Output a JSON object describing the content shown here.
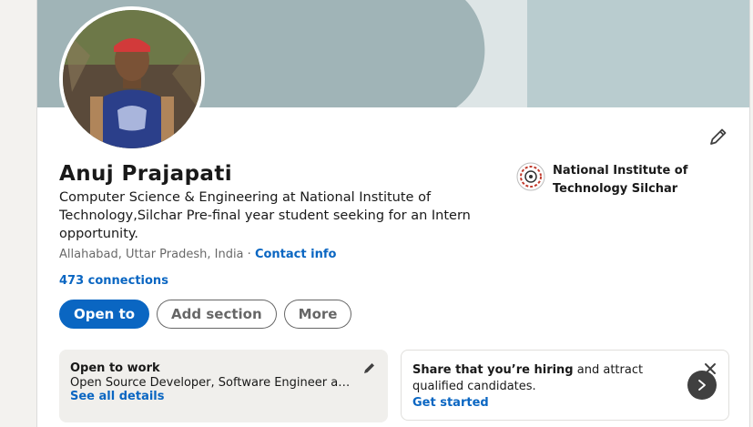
{
  "profile": {
    "name": "Anuj Prajapati",
    "headline": "Computer Science & Engineering at National Institute of Technology,Silchar Pre-final year student seeking for an Intern opportunity.",
    "location": "Allahabad, Uttar Pradesh, India",
    "separator": "·",
    "contact_info_label": "Contact info",
    "connections_label": "473 connections"
  },
  "actions": {
    "open_to_label": "Open to",
    "add_section_label": "Add section",
    "more_label": "More"
  },
  "education": {
    "school_name": "National Institute of Technology Silchar"
  },
  "open_to_work": {
    "title": "Open to work",
    "roles": "Open Source Developer, Software Engineer an…",
    "link_label": "See all details"
  },
  "hiring": {
    "bold_text": "Share that you’re hiring",
    "rest_text": " and attract qualified candidates.",
    "link_label": "Get started"
  },
  "icons": {
    "edit": "pencil-icon",
    "close": "close-icon",
    "next": "chevron-right-icon"
  },
  "colors": {
    "accent": "#0a66c2",
    "banner": "#a0b4b7",
    "page_bg": "#f3f2ef"
  }
}
